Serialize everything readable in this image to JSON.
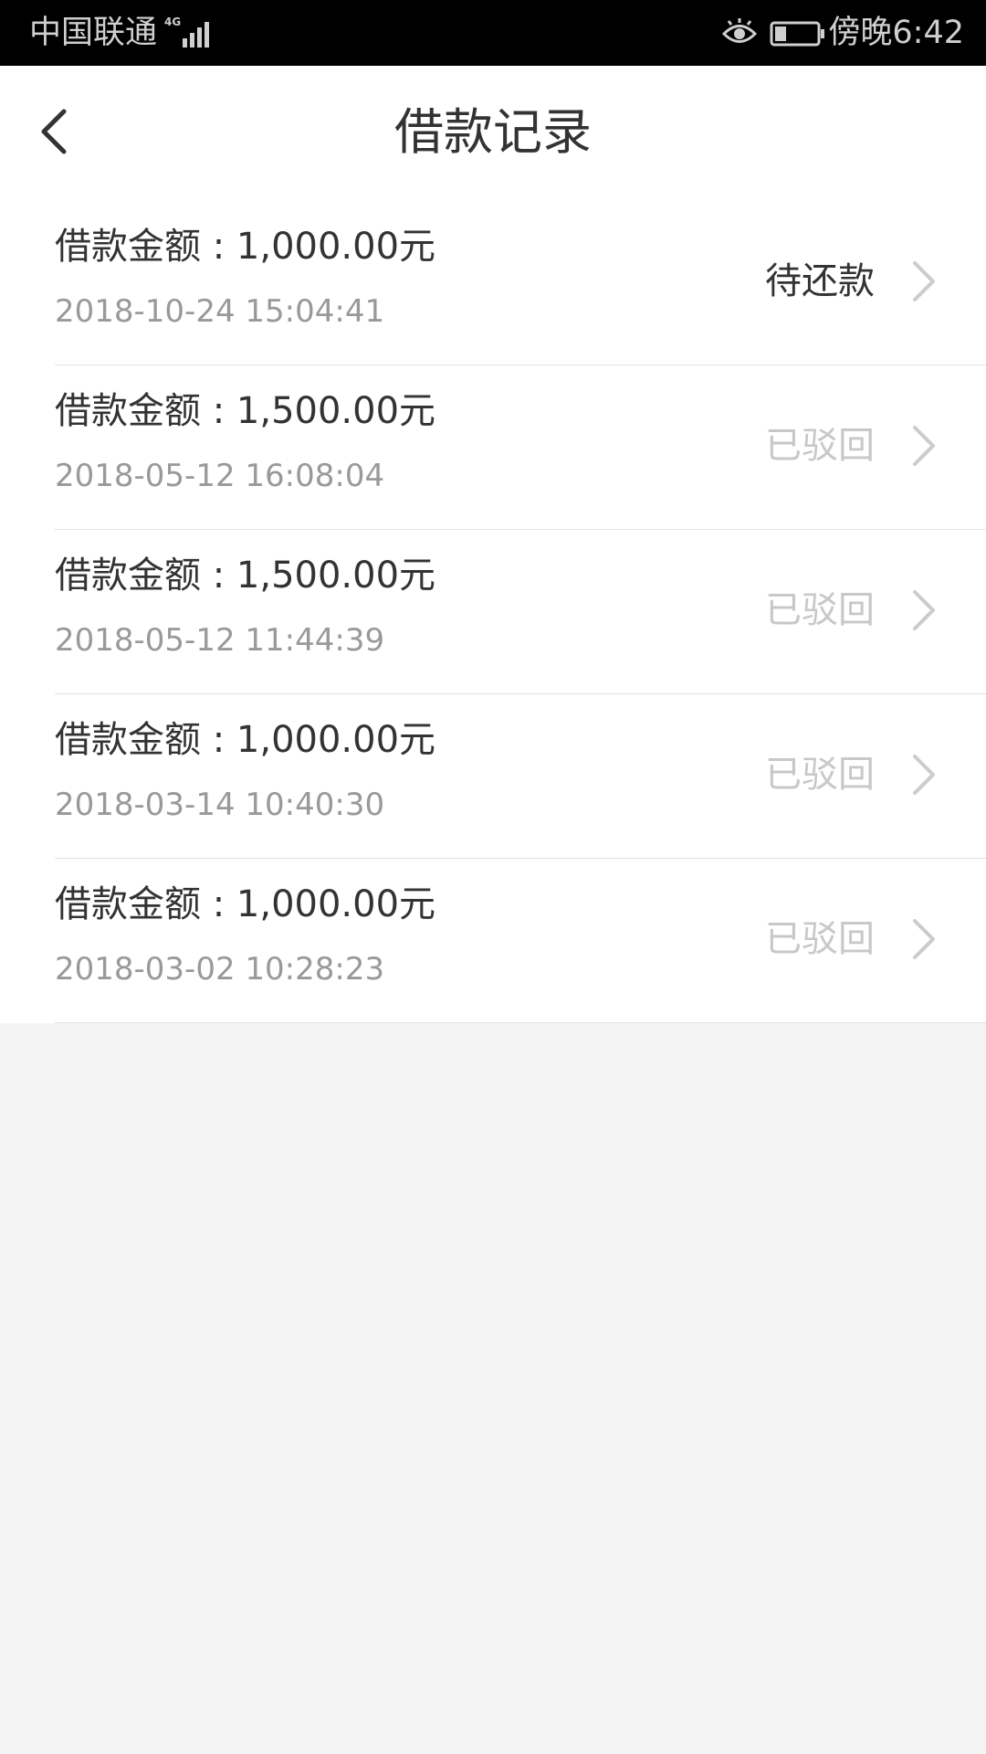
{
  "status_bar": {
    "carrier": "中国联通",
    "network": "4G",
    "time": "傍晚6:42"
  },
  "header": {
    "title": "借款记录"
  },
  "records": [
    {
      "amount_label": "借款金额 : 1,000.00元",
      "time": "2018-10-24 15:04:41",
      "status": "待还款"
    },
    {
      "amount_label": "借款金额 : 1,500.00元",
      "time": "2018-05-12 16:08:04",
      "status": "已驳回"
    },
    {
      "amount_label": "借款金额 : 1,500.00元",
      "time": "2018-05-12 11:44:39",
      "status": "已驳回"
    },
    {
      "amount_label": "借款金额 : 1,000.00元",
      "time": "2018-03-14 10:40:30",
      "status": "已驳回"
    },
    {
      "amount_label": "借款金额 : 1,000.00元",
      "time": "2018-03-02 10:28:23",
      "status": "已驳回"
    }
  ],
  "colors": {
    "status_pending": "#333333",
    "status_rejected": "#c8c8c8",
    "background": "#f4f4f4"
  }
}
